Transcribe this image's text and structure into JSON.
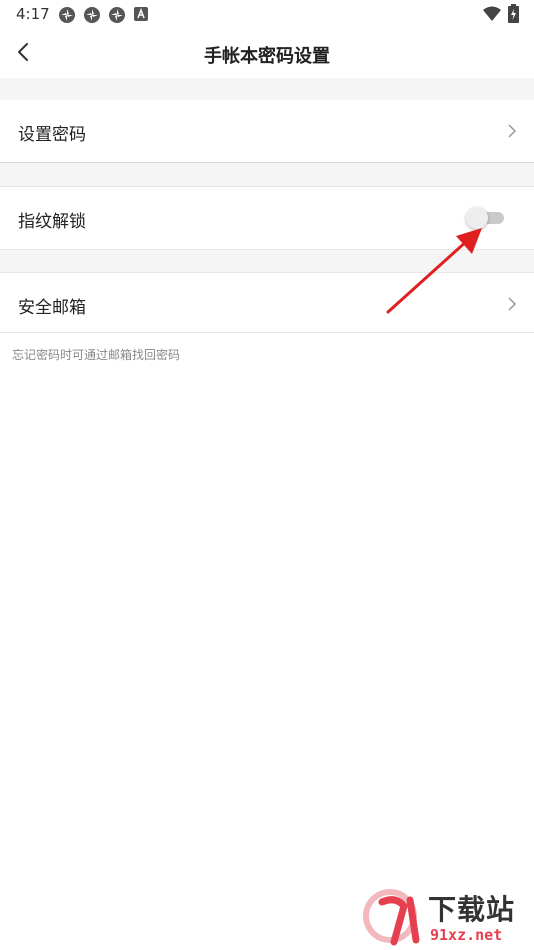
{
  "status_bar": {
    "time": "4:17",
    "icons": [
      "notification-icon",
      "notification-icon",
      "notification-icon",
      "a-icon",
      "wifi-icon",
      "battery-icon"
    ]
  },
  "header": {
    "title": "手帐本密码设置"
  },
  "settings": {
    "items": [
      {
        "label": "设置密码",
        "control": "chevron"
      },
      {
        "label": "指纹解锁",
        "control": "toggle",
        "toggle_on": false
      },
      {
        "label": "安全邮箱",
        "control": "chevron"
      }
    ],
    "hint": "忘记密码时可通过邮箱找回密码"
  },
  "watermark": {
    "cn": "下载站",
    "en": "91xz.net"
  },
  "colors": {
    "annotation_arrow": "#e02020",
    "gap_bg": "#f5f5f5",
    "watermark_red": "#e5404f"
  }
}
